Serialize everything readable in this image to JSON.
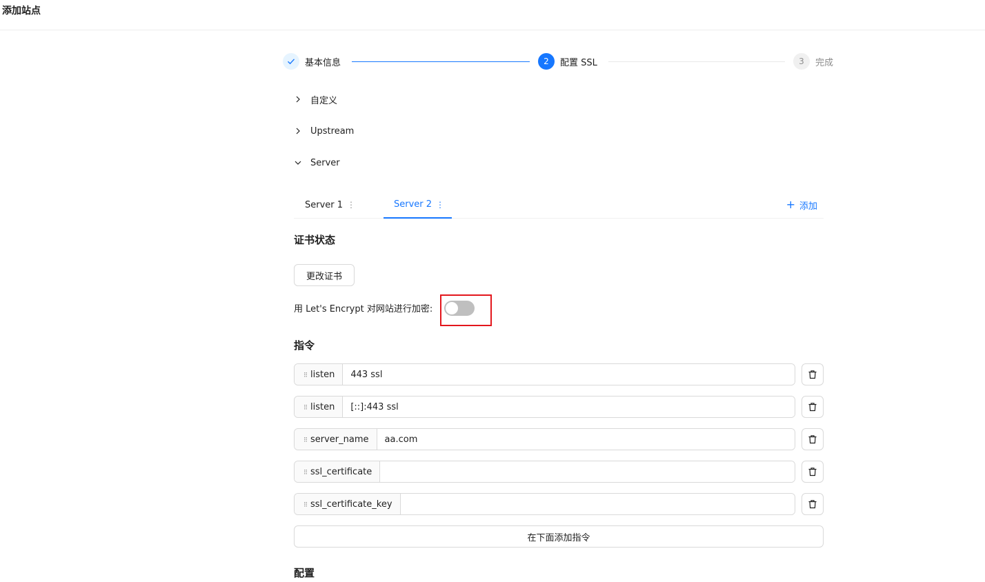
{
  "page": {
    "title": "添加站点"
  },
  "steps": [
    {
      "label": "基本信息",
      "state": "done"
    },
    {
      "number": "2",
      "label": "配置 SSL",
      "state": "active"
    },
    {
      "number": "3",
      "label": "完成",
      "state": "pending"
    }
  ],
  "collapse": [
    {
      "label": "自定义",
      "expanded": false
    },
    {
      "label": "Upstream",
      "expanded": false
    },
    {
      "label": "Server",
      "expanded": true
    }
  ],
  "tabs": {
    "items": [
      {
        "label": "Server 1",
        "active": false
      },
      {
        "label": "Server 2",
        "active": true
      }
    ],
    "add_label": "添加"
  },
  "cert": {
    "title": "证书状态",
    "change_button": "更改证书",
    "letsencrypt_label": "用 Let's Encrypt 对网站进行加密:",
    "letsencrypt_enabled": false
  },
  "directives": {
    "title": "指令",
    "items": [
      {
        "name": "listen",
        "value": "443 ssl"
      },
      {
        "name": "listen",
        "value": "[::]:443 ssl"
      },
      {
        "name": "server_name",
        "value": "aa.com"
      },
      {
        "name": "ssl_certificate",
        "value": ""
      },
      {
        "name": "ssl_certificate_key",
        "value": ""
      }
    ],
    "add_below": "在下面添加指令"
  },
  "config": {
    "title": "配置"
  },
  "colors": {
    "primary": "#1677ff",
    "highlight": "#e3161c",
    "switch_off": "#bfbfbf"
  }
}
